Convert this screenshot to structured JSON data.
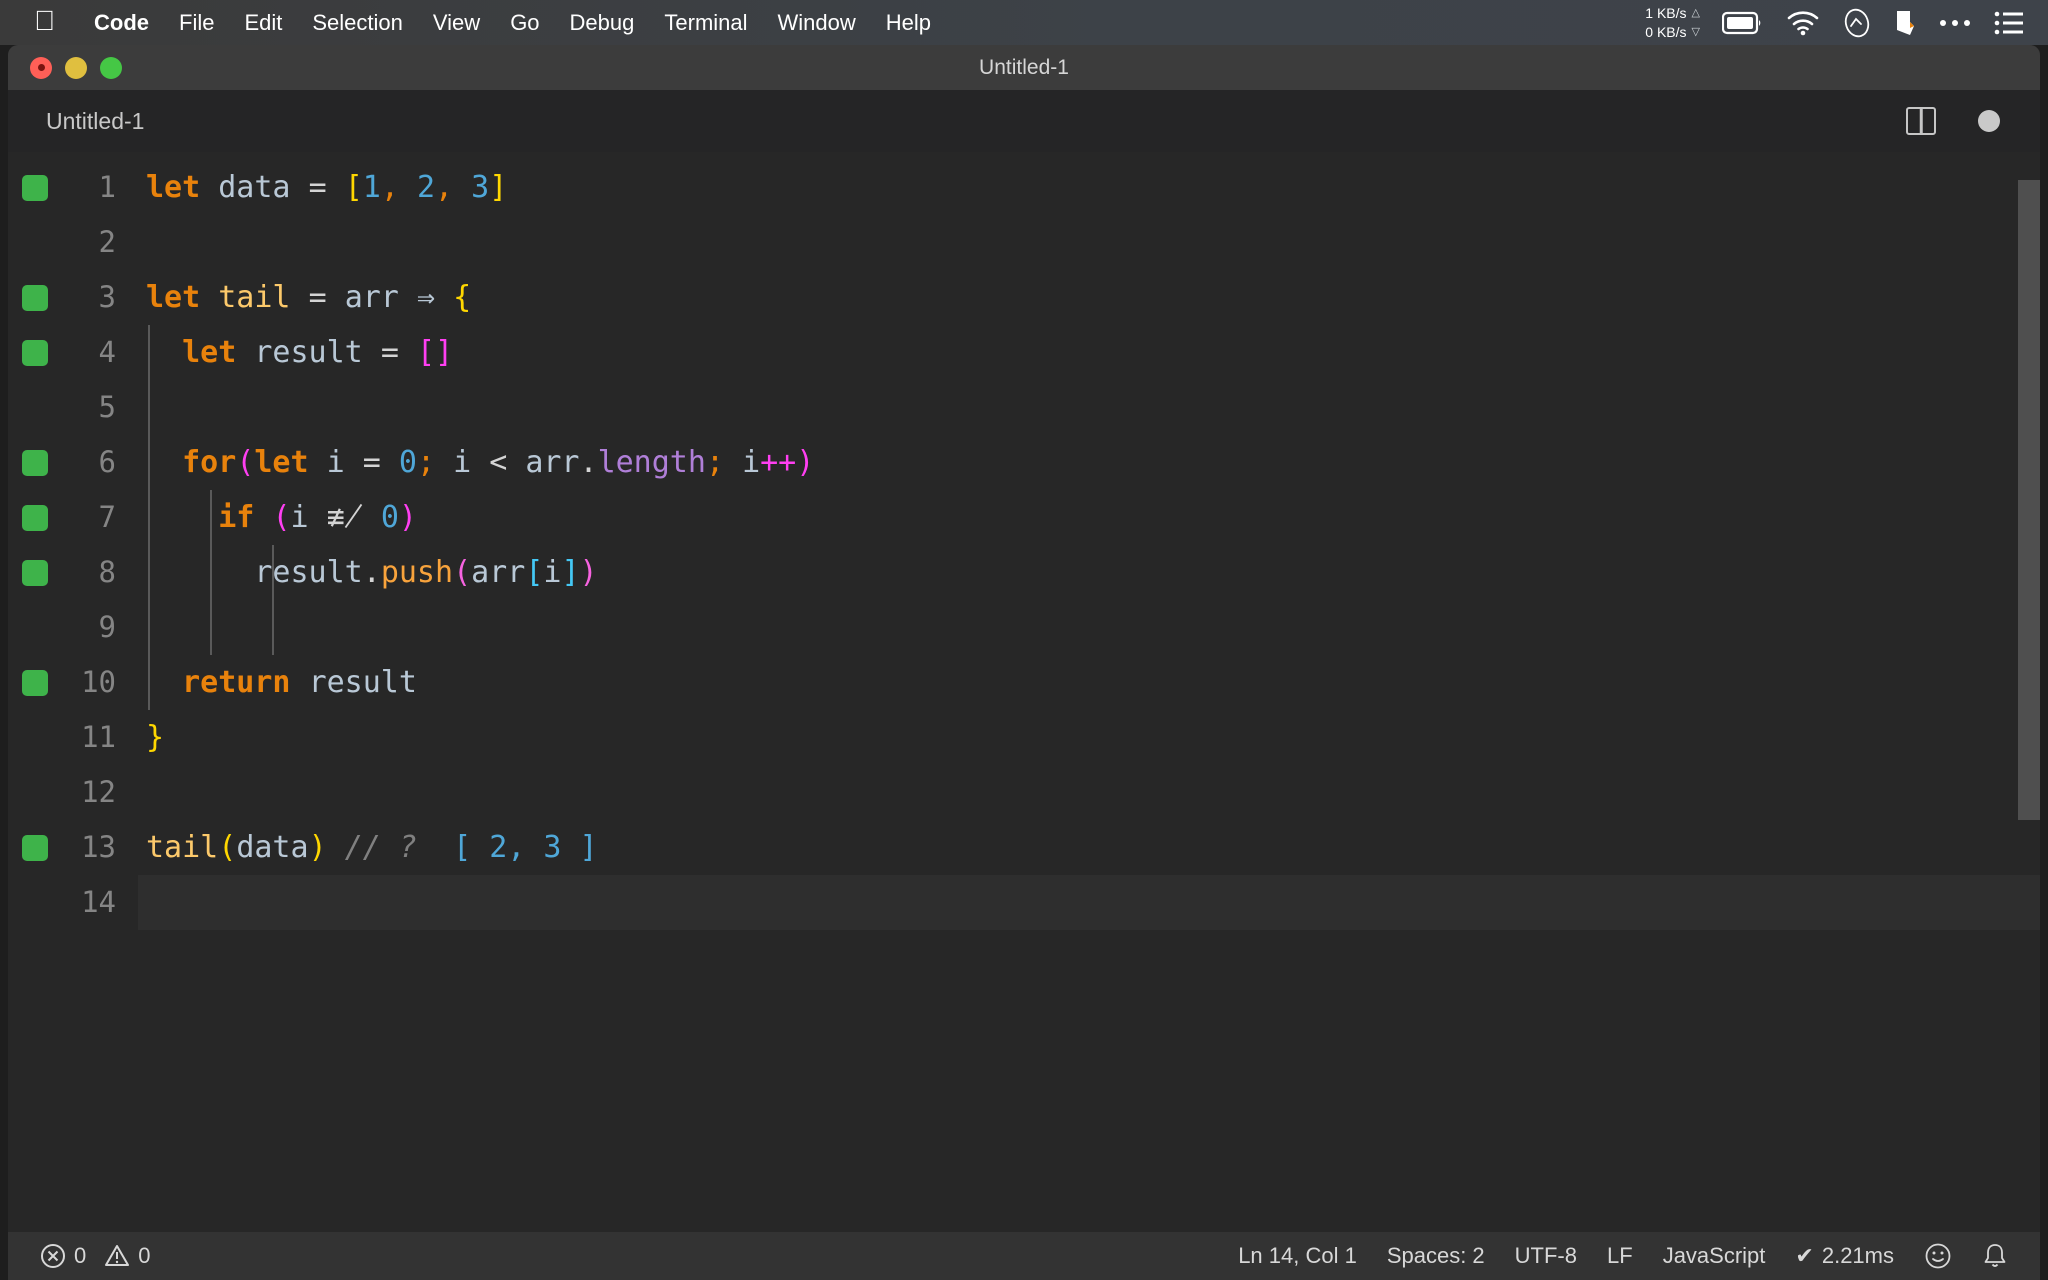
{
  "menubar": {
    "apple_icon": "apple-logo",
    "items": [
      {
        "label": "Code",
        "bold": true
      },
      {
        "label": "File",
        "bold": false
      },
      {
        "label": "Edit",
        "bold": false
      },
      {
        "label": "Selection",
        "bold": false
      },
      {
        "label": "View",
        "bold": false
      },
      {
        "label": "Go",
        "bold": false
      },
      {
        "label": "Debug",
        "bold": false
      },
      {
        "label": "Terminal",
        "bold": false
      },
      {
        "label": "Window",
        "bold": false
      },
      {
        "label": "Help",
        "bold": false
      }
    ],
    "status": {
      "upload_speed": "1 KB/s",
      "download_speed": "0 KB/s",
      "up_arrow": "△",
      "down_arrow": "▽",
      "icons": [
        "battery-icon",
        "wifi-icon",
        "siri-icon",
        "dropbox-icon",
        "ellipsis-icon",
        "control-center-icon"
      ]
    }
  },
  "window": {
    "title": "Untitled-1",
    "traffic_lights": [
      "close-button",
      "minimize-button",
      "maximize-button"
    ]
  },
  "tabbar": {
    "tabs": [
      {
        "label": "Untitled-1",
        "active": true
      }
    ],
    "actions": [
      "split-editor-icon",
      "unsaved-dot-icon"
    ]
  },
  "editor": {
    "language": "JavaScript",
    "lines": [
      {
        "num": "1",
        "marked": true,
        "indent": 0,
        "current": false,
        "tokens": [
          {
            "t": "let",
            "c": "t-kw"
          },
          {
            "t": " ",
            "c": "t-op"
          },
          {
            "t": "data",
            "c": "t-var"
          },
          {
            "t": " ",
            "c": "t-op"
          },
          {
            "t": "=",
            "c": "t-op"
          },
          {
            "t": " ",
            "c": "t-op"
          },
          {
            "t": "[",
            "c": "t-brk-y"
          },
          {
            "t": "1",
            "c": "t-num"
          },
          {
            "t": ",",
            "c": "t-semi"
          },
          {
            "t": " ",
            "c": "t-op"
          },
          {
            "t": "2",
            "c": "t-num"
          },
          {
            "t": ",",
            "c": "t-semi"
          },
          {
            "t": " ",
            "c": "t-op"
          },
          {
            "t": "3",
            "c": "t-num"
          },
          {
            "t": "]",
            "c": "t-brk-y"
          }
        ]
      },
      {
        "num": "2",
        "marked": false,
        "indent": 0,
        "current": false,
        "tokens": []
      },
      {
        "num": "3",
        "marked": true,
        "indent": 0,
        "current": false,
        "tokens": [
          {
            "t": "let",
            "c": "t-kw"
          },
          {
            "t": " ",
            "c": "t-op"
          },
          {
            "t": "tail",
            "c": "t-fn"
          },
          {
            "t": " ",
            "c": "t-op"
          },
          {
            "t": "=",
            "c": "t-op"
          },
          {
            "t": " ",
            "c": "t-op"
          },
          {
            "t": "arr",
            "c": "t-var"
          },
          {
            "t": " ",
            "c": "t-op"
          },
          {
            "t": "⇒",
            "c": "t-arrow"
          },
          {
            "t": " ",
            "c": "t-op"
          },
          {
            "t": "{",
            "c": "t-brk-y"
          }
        ]
      },
      {
        "num": "4",
        "marked": true,
        "indent": 1,
        "current": false,
        "tokens": [
          {
            "t": "  ",
            "c": "t-op"
          },
          {
            "t": "let",
            "c": "t-kw"
          },
          {
            "t": " ",
            "c": "t-op"
          },
          {
            "t": "result",
            "c": "t-var"
          },
          {
            "t": " ",
            "c": "t-op"
          },
          {
            "t": "=",
            "c": "t-op"
          },
          {
            "t": " ",
            "c": "t-op"
          },
          {
            "t": "[",
            "c": "t-brk-m"
          },
          {
            "t": "]",
            "c": "t-brk-m"
          }
        ]
      },
      {
        "num": "5",
        "marked": false,
        "indent": 1,
        "current": false,
        "tokens": []
      },
      {
        "num": "6",
        "marked": true,
        "indent": 1,
        "current": false,
        "tokens": [
          {
            "t": "  ",
            "c": "t-op"
          },
          {
            "t": "for",
            "c": "t-kw"
          },
          {
            "t": "(",
            "c": "t-brk-m"
          },
          {
            "t": "let",
            "c": "t-kw"
          },
          {
            "t": " ",
            "c": "t-op"
          },
          {
            "t": "i",
            "c": "t-var"
          },
          {
            "t": " ",
            "c": "t-op"
          },
          {
            "t": "=",
            "c": "t-op"
          },
          {
            "t": " ",
            "c": "t-op"
          },
          {
            "t": "0",
            "c": "t-num"
          },
          {
            "t": ";",
            "c": "t-semi"
          },
          {
            "t": " ",
            "c": "t-op"
          },
          {
            "t": "i",
            "c": "t-var"
          },
          {
            "t": " ",
            "c": "t-op"
          },
          {
            "t": "<",
            "c": "t-op"
          },
          {
            "t": " ",
            "c": "t-op"
          },
          {
            "t": "arr",
            "c": "t-var"
          },
          {
            "t": ".",
            "c": "t-op"
          },
          {
            "t": "length",
            "c": "t-prop"
          },
          {
            "t": ";",
            "c": "t-semi"
          },
          {
            "t": " ",
            "c": "t-op"
          },
          {
            "t": "i",
            "c": "t-var"
          },
          {
            "t": "++",
            "c": "t-brk-m"
          },
          {
            "t": ")",
            "c": "t-brk-m"
          }
        ]
      },
      {
        "num": "7",
        "marked": true,
        "indent": 2,
        "current": false,
        "tokens": [
          {
            "t": "    ",
            "c": "t-op"
          },
          {
            "t": "if",
            "c": "t-kw"
          },
          {
            "t": " ",
            "c": "t-op"
          },
          {
            "t": "(",
            "c": "t-brk-m"
          },
          {
            "t": "i",
            "c": "t-var"
          },
          {
            "t": " ",
            "c": "t-op"
          },
          {
            "t": "≢̸",
            "c": "t-op"
          },
          {
            "t": " ",
            "c": "t-op"
          },
          {
            "t": "0",
            "c": "t-num"
          },
          {
            "t": ")",
            "c": "t-brk-m"
          }
        ]
      },
      {
        "num": "8",
        "marked": true,
        "indent": 3,
        "current": false,
        "tokens": [
          {
            "t": "      ",
            "c": "t-op"
          },
          {
            "t": "result",
            "c": "t-var"
          },
          {
            "t": ".",
            "c": "t-op"
          },
          {
            "t": "push",
            "c": "t-method"
          },
          {
            "t": "(",
            "c": "t-brk-mag"
          },
          {
            "t": "arr",
            "c": "t-var"
          },
          {
            "t": "[",
            "c": "t-brk-c"
          },
          {
            "t": "i",
            "c": "t-var"
          },
          {
            "t": "]",
            "c": "t-brk-c"
          },
          {
            "t": ")",
            "c": "t-brk-mag"
          }
        ]
      },
      {
        "num": "9",
        "marked": false,
        "indent": 3,
        "current": false,
        "tokens": []
      },
      {
        "num": "10",
        "marked": true,
        "indent": 1,
        "current": false,
        "tokens": [
          {
            "t": "  ",
            "c": "t-op"
          },
          {
            "t": "return",
            "c": "t-kw"
          },
          {
            "t": " ",
            "c": "t-op"
          },
          {
            "t": "result",
            "c": "t-var"
          }
        ]
      },
      {
        "num": "11",
        "marked": false,
        "indent": 0,
        "current": false,
        "tokens": [
          {
            "t": "}",
            "c": "t-brk-y"
          }
        ]
      },
      {
        "num": "12",
        "marked": false,
        "indent": 0,
        "current": false,
        "tokens": []
      },
      {
        "num": "13",
        "marked": true,
        "indent": 0,
        "current": false,
        "tokens": [
          {
            "t": "tail",
            "c": "t-fn"
          },
          {
            "t": "(",
            "c": "t-brk-y"
          },
          {
            "t": "data",
            "c": "t-var"
          },
          {
            "t": ")",
            "c": "t-brk-y"
          },
          {
            "t": " ",
            "c": "t-op"
          },
          {
            "t": "// ?",
            "c": "t-comment"
          },
          {
            "t": "  ",
            "c": "t-op"
          },
          {
            "t": "[ ",
            "c": "t-num"
          },
          {
            "t": "2",
            "c": "t-num"
          },
          {
            "t": ", ",
            "c": "t-num"
          },
          {
            "t": "3",
            "c": "t-num"
          },
          {
            "t": " ]",
            "c": "t-num"
          }
        ]
      },
      {
        "num": "14",
        "marked": false,
        "indent": 0,
        "current": true,
        "tokens": []
      }
    ]
  },
  "statusbar": {
    "errors": "0",
    "warnings": "0",
    "error_icon": "error-circle-icon",
    "warning_icon": "warning-triangle-icon",
    "cursor_position": "Ln 14, Col 1",
    "indentation": "Spaces: 2",
    "encoding": "UTF-8",
    "eol": "LF",
    "language": "JavaScript",
    "runtime": "2.21ms",
    "runtime_check": "✔",
    "feedback_icon": "smiley-icon",
    "notifications_icon": "bell-icon"
  },
  "colors": {
    "menubar_bg": "#3d4248",
    "titlebar_bg": "#3c3c3c",
    "editor_bg": "#272727",
    "statusbar_bg": "#333333",
    "marker_green": "#3eb34a",
    "keyword_orange": "#e8820c",
    "number_blue": "#4fa7d8"
  }
}
